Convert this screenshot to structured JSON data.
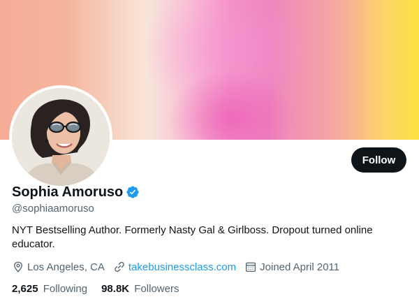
{
  "profile": {
    "display_name": "Sophia Amoruso",
    "handle": "@sophiaamoruso",
    "verified": true,
    "bio": "NYT Bestselling Author. Formerly Nasty Gal & Girlboss. Dropout turned online educator.",
    "follow_label": "Follow"
  },
  "meta": {
    "location": "Los Angeles, CA",
    "location_icon": "location-pin-icon",
    "website": "takebusinessclass.com",
    "website_icon": "link-icon",
    "joined": "Joined April 2011",
    "joined_icon": "calendar-icon"
  },
  "stats": {
    "following_count": "2,625",
    "following_label": "Following",
    "followers_count": "98.8K",
    "followers_label": "Followers"
  },
  "colors": {
    "accent": "#1d9bf0",
    "verified_badge": "#1d9bf0",
    "follow_button_bg": "#0f1419",
    "secondary_text": "#536471"
  }
}
